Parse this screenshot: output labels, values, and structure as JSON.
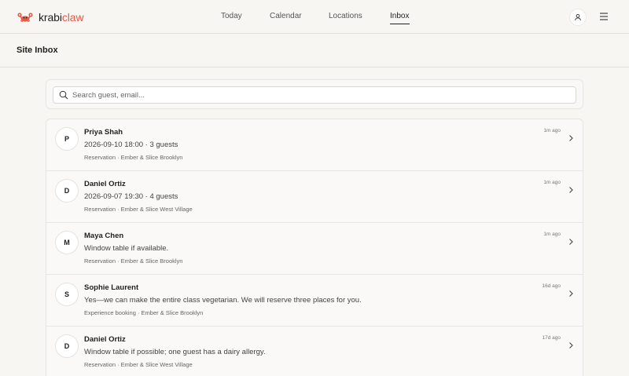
{
  "brand": {
    "name_part1": "krabi",
    "name_part2": "claw",
    "accent": "#e45b47"
  },
  "nav": {
    "items": [
      {
        "label": "Today"
      },
      {
        "label": "Calendar"
      },
      {
        "label": "Locations"
      },
      {
        "label": "Inbox",
        "active": true
      }
    ]
  },
  "header_icons": [
    "user-icon",
    "hamburger-menu-icon"
  ],
  "page": {
    "title": "Site Inbox"
  },
  "search": {
    "placeholder": "Search guest, email...",
    "value": ""
  },
  "messages": [
    {
      "initial": "P",
      "name": "Priya Shah",
      "message": "2026-09-10 18:00 · 3 guests",
      "meta": "Reservation · Ember & Slice Brooklyn",
      "time": "1m ago"
    },
    {
      "initial": "D",
      "name": "Daniel Ortiz",
      "message": "2026-09-07 19:30 · 4 guests",
      "meta": "Reservation · Ember & Slice West Village",
      "time": "1m ago"
    },
    {
      "initial": "M",
      "name": "Maya Chen",
      "message": "Window table if available.",
      "meta": "Reservation · Ember & Slice Brooklyn",
      "time": "1m ago"
    },
    {
      "initial": "S",
      "name": "Sophie Laurent",
      "message": "Yes—we can make the entire class vegetarian. We will reserve three places for you.",
      "meta": "Experience booking · Ember & Slice Brooklyn",
      "time": "16d ago"
    },
    {
      "initial": "D",
      "name": "Daniel Ortiz",
      "message": "Window table if possible; one guest has a dairy allergy.",
      "meta": "Reservation · Ember & Slice West Village",
      "time": "17d ago"
    }
  ]
}
